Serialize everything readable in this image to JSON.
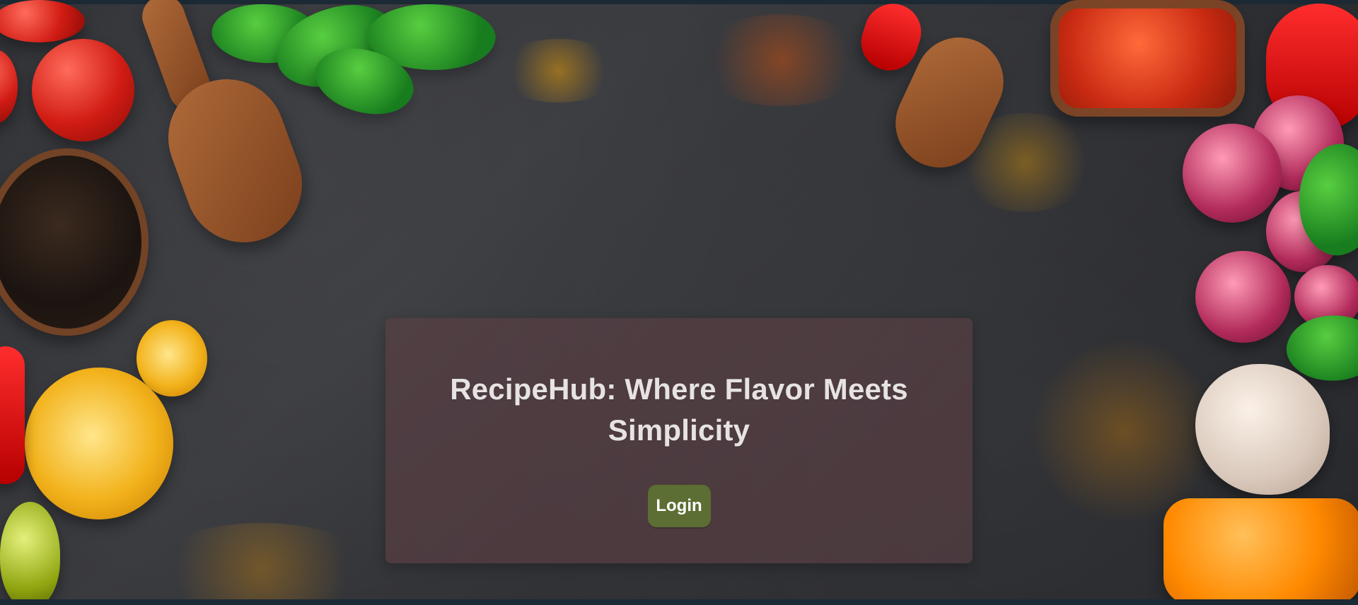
{
  "hero": {
    "title": "RecipeHub: Where Flavor Meets Simplicity",
    "login_label": "Login"
  },
  "colors": {
    "panel_bg": "#5c3f44",
    "button_bg": "#5c6e33",
    "button_text": "#ffffff",
    "title_text": "#e7e3e3"
  }
}
